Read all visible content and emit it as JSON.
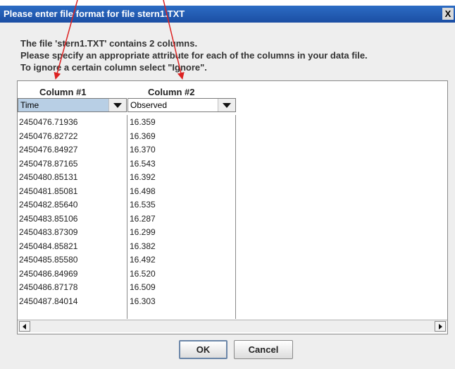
{
  "dialog": {
    "title": "Please enter file format for file stern1.TXT",
    "close_label": "X",
    "message_lines": [
      "The file 'stern1.TXT' contains 2 columns.",
      "Please specify an appropriate attribute for each of the columns in your data file.",
      "To ignore a certain column select \"Ignore\"."
    ]
  },
  "columns": [
    {
      "header": "Column #1",
      "selected": "Time"
    },
    {
      "header": "Column #2",
      "selected": "Observed"
    }
  ],
  "rows": [
    [
      "2450476.71936",
      "16.359"
    ],
    [
      "2450476.82722",
      "16.369"
    ],
    [
      "2450476.84927",
      "16.370"
    ],
    [
      "2450478.87165",
      "16.543"
    ],
    [
      "2450480.85131",
      "16.392"
    ],
    [
      "2450481.85081",
      "16.498"
    ],
    [
      "2450482.85640",
      "16.535"
    ],
    [
      "2450483.85106",
      "16.287"
    ],
    [
      "2450483.87309",
      "16.299"
    ],
    [
      "2450484.85821",
      "16.382"
    ],
    [
      "2450485.85580",
      "16.492"
    ],
    [
      "2450486.84969",
      "16.520"
    ],
    [
      "2450486.87178",
      "16.509"
    ],
    [
      "2450487.84014",
      "16.303"
    ]
  ],
  "buttons": {
    "ok": "OK",
    "cancel": "Cancel"
  },
  "colors": {
    "title_bar": "#1f57b0",
    "selected_combo": "#b8cfe5",
    "annotation_arrow": "#dd2222"
  }
}
